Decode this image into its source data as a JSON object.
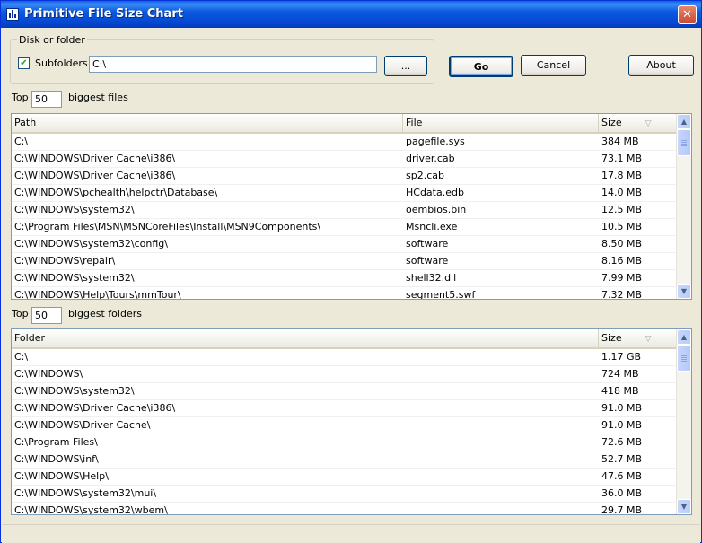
{
  "window": {
    "title": "Primitive File Size Chart",
    "close_glyph": "✕"
  },
  "disk": {
    "group_label": "Disk or folder",
    "subfolders_checked": true,
    "check_glyph": "✔",
    "subfolders_label": "Subfolders",
    "path_value": "C:\\",
    "browse_label": "..."
  },
  "buttons": {
    "go": "Go",
    "cancel": "Cancel",
    "about": "About"
  },
  "files": {
    "top_label": "Top",
    "top_value": "50",
    "suffix_label": "biggest files",
    "columns": {
      "path": "Path",
      "file": "File",
      "size": "Size"
    },
    "sort_glyph": "▽",
    "rows": [
      {
        "path": "C:\\",
        "file": "pagefile.sys",
        "size": "384 MB"
      },
      {
        "path": "C:\\WINDOWS\\Driver Cache\\i386\\",
        "file": "driver.cab",
        "size": "73.1 MB"
      },
      {
        "path": "C:\\WINDOWS\\Driver Cache\\i386\\",
        "file": "sp2.cab",
        "size": "17.8 MB"
      },
      {
        "path": "C:\\WINDOWS\\pchealth\\helpctr\\Database\\",
        "file": "HCdata.edb",
        "size": "14.0 MB"
      },
      {
        "path": "C:\\WINDOWS\\system32\\",
        "file": "oembios.bin",
        "size": "12.5 MB"
      },
      {
        "path": "C:\\Program Files\\MSN\\MSNCoreFiles\\Install\\MSN9Components\\",
        "file": "Msncli.exe",
        "size": "10.5 MB"
      },
      {
        "path": "C:\\WINDOWS\\system32\\config\\",
        "file": "software",
        "size": "8.50 MB"
      },
      {
        "path": "C:\\WINDOWS\\repair\\",
        "file": "software",
        "size": "8.16 MB"
      },
      {
        "path": "C:\\WINDOWS\\system32\\",
        "file": "shell32.dll",
        "size": "7.99 MB"
      },
      {
        "path": "C:\\WINDOWS\\Help\\Tours\\mmTour\\",
        "file": "segment5.swf",
        "size": "7.32 MB"
      }
    ]
  },
  "folders": {
    "top_label": "Top",
    "top_value": "50",
    "suffix_label": "biggest folders",
    "columns": {
      "folder": "Folder",
      "size": "Size"
    },
    "sort_glyph": "▽",
    "rows": [
      {
        "folder": "C:\\",
        "size": "1.17 GB"
      },
      {
        "folder": "C:\\WINDOWS\\",
        "size": "724 MB"
      },
      {
        "folder": "C:\\WINDOWS\\system32\\",
        "size": "418 MB"
      },
      {
        "folder": "C:\\WINDOWS\\Driver Cache\\i386\\",
        "size": "91.0 MB"
      },
      {
        "folder": "C:\\WINDOWS\\Driver Cache\\",
        "size": "91.0 MB"
      },
      {
        "folder": "C:\\Program Files\\",
        "size": "72.6 MB"
      },
      {
        "folder": "C:\\WINDOWS\\inf\\",
        "size": "52.7 MB"
      },
      {
        "folder": "C:\\WINDOWS\\Help\\",
        "size": "47.6 MB"
      },
      {
        "folder": "C:\\WINDOWS\\system32\\mui\\",
        "size": "36.0 MB"
      },
      {
        "folder": "C:\\WINDOWS\\system32\\wbem\\",
        "size": "29.7 MB"
      }
    ]
  },
  "scrollbar": {
    "up_glyph": "▲",
    "down_glyph": "▼"
  }
}
